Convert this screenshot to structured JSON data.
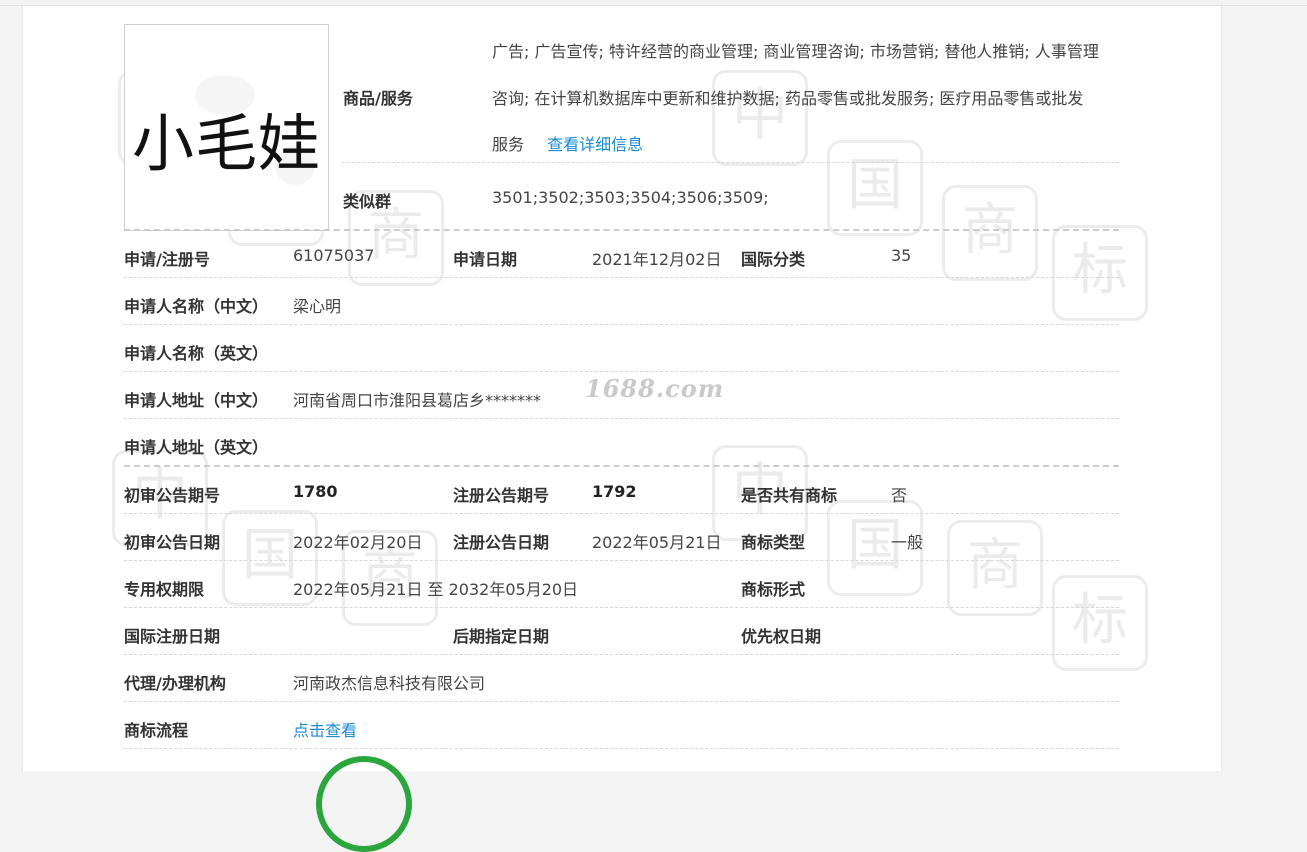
{
  "logo": {
    "text": "小毛娃"
  },
  "watermark": {
    "chars": [
      "中",
      "国",
      "商",
      "标"
    ],
    "site": "1688.com"
  },
  "goods": {
    "label": "商品/服务",
    "lines": [
      "广告; 广告宣传; 特许经营的商业管理; 商业管理咨询; 市场营销; 替他人推销; 人事管理",
      "咨询; 在计算机数据库中更新和维护数据; 药品零售或批发服务; 医疗用品零售或批发",
      "服务"
    ],
    "detail_link": "查看详细信息"
  },
  "similar_group": {
    "label": "类似群",
    "value": "3501;3502;3503;3504;3506;3509;"
  },
  "rows": {
    "reg_no": {
      "label": "申请/注册号",
      "value": "61075037"
    },
    "apply_date": {
      "label": "申请日期",
      "value": "2021年12月02日"
    },
    "intl_class": {
      "label": "国际分类",
      "value": "35"
    },
    "applicant_cn": {
      "label": "申请人名称（中文）",
      "value": "梁心明"
    },
    "applicant_en": {
      "label": "申请人名称（英文）",
      "value": ""
    },
    "address_cn": {
      "label": "申请人地址（中文）",
      "value": "河南省周口市淮阳县葛店乡*******"
    },
    "address_en": {
      "label": "申请人地址（英文）",
      "value": ""
    },
    "prelim_issue": {
      "label": "初审公告期号",
      "value": "1780"
    },
    "reg_issue": {
      "label": "注册公告期号",
      "value": "1792"
    },
    "shared": {
      "label": "是否共有商标",
      "value": "否"
    },
    "prelim_date": {
      "label": "初审公告日期",
      "value": "2022年02月20日"
    },
    "reg_date": {
      "label": "注册公告日期",
      "value": "2022年05月21日"
    },
    "tm_type": {
      "label": "商标类型",
      "value": "一般"
    },
    "exclusive": {
      "label": "专用权期限",
      "value": "2022年05月21日 至 2032年05月20日"
    },
    "tm_form": {
      "label": "商标形式",
      "value": ""
    },
    "intl_reg_date": {
      "label": "国际注册日期",
      "value": ""
    },
    "later_date": {
      "label": "后期指定日期",
      "value": ""
    },
    "priority_date": {
      "label": "优先权日期",
      "value": ""
    },
    "agent": {
      "label": "代理/办理机构",
      "value": "河南政杰信息科技有限公司"
    },
    "process": {
      "label": "商标流程",
      "value": "点击查看"
    }
  }
}
